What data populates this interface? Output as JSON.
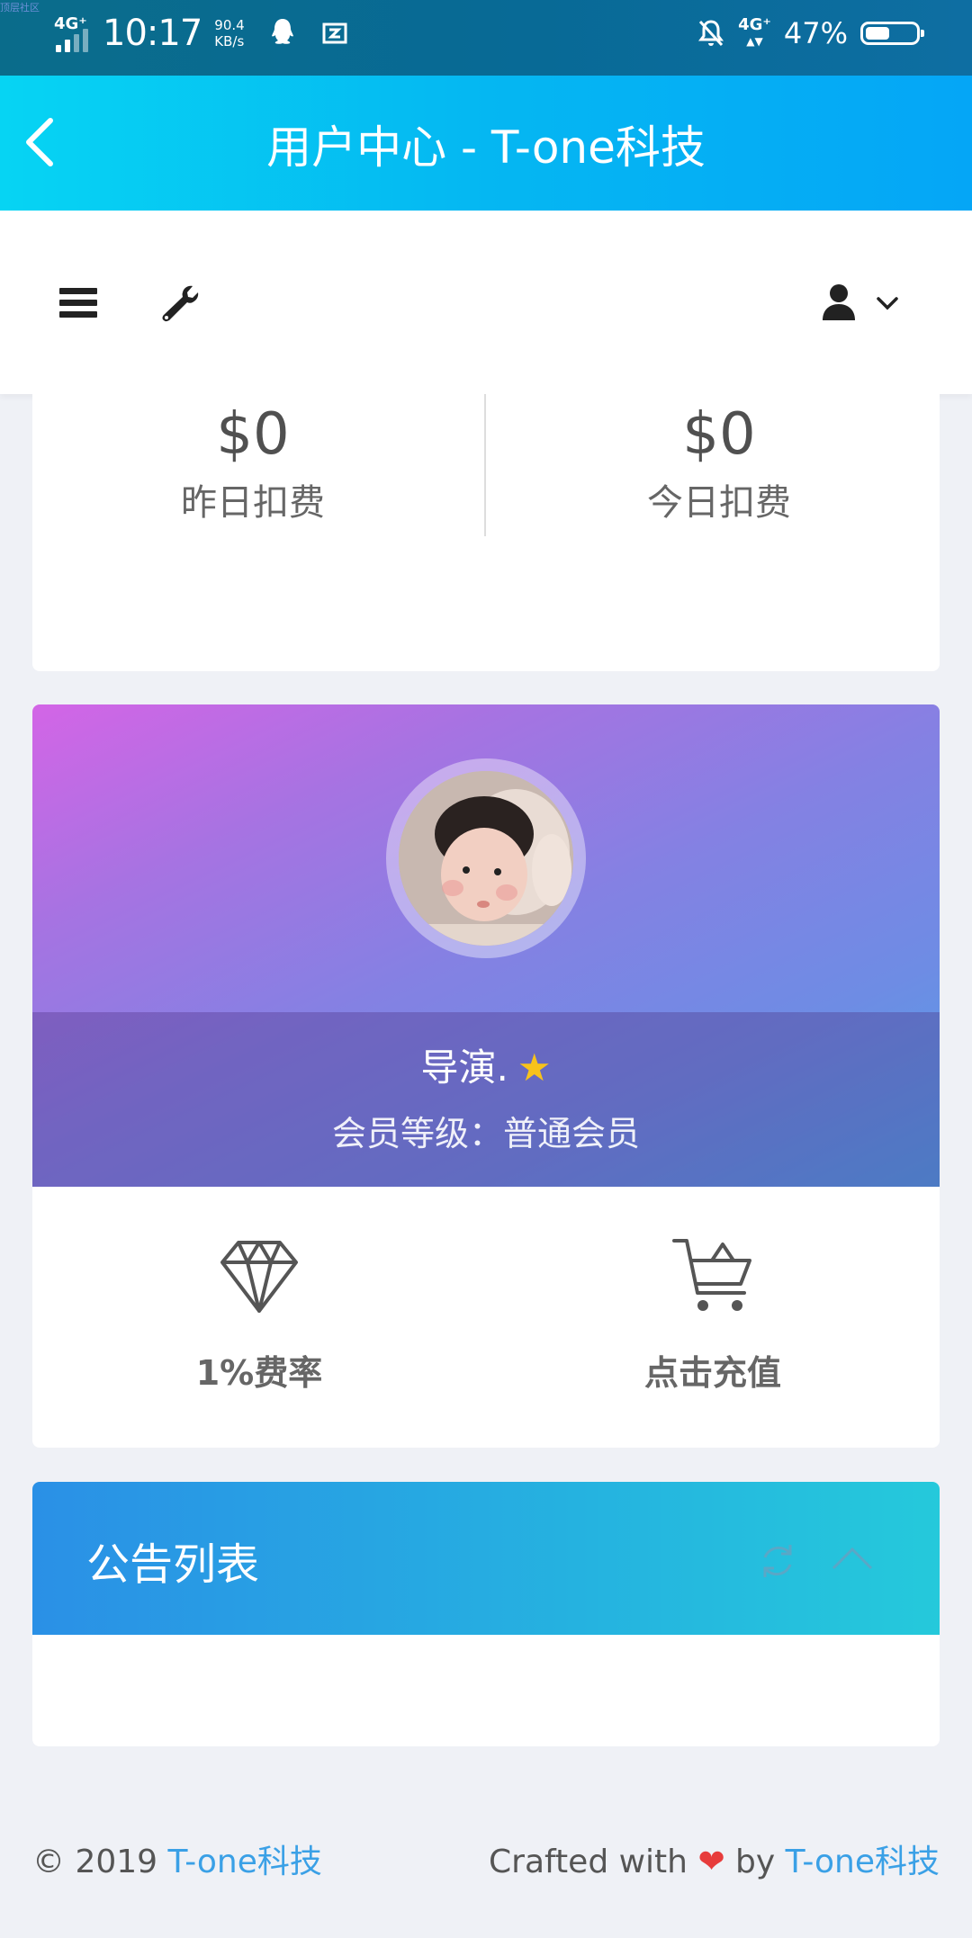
{
  "status_bar": {
    "watermark": "顶层社区",
    "network_left": "4G⁺",
    "time": "10:17",
    "speed_value": "90.4",
    "speed_unit": "KB/s",
    "network_right": "4G⁺",
    "battery": "47%",
    "battery_level": 0.47
  },
  "appbar": {
    "title": "用户中心 - T-one科技"
  },
  "stats": {
    "yesterday": {
      "value": "$0",
      "label": "昨日扣费"
    },
    "today": {
      "value": "$0",
      "label": "今日扣费"
    }
  },
  "profile": {
    "name": "导演.",
    "star": "★",
    "level": "会员等级：普通会员",
    "rate_label": "1%费率",
    "recharge_label": "点击充值"
  },
  "notice": {
    "title": "公告列表"
  },
  "footer": {
    "copyright": "© 2019 ",
    "brand": "T-one科技",
    "crafted": "Crafted with ",
    "heart": "❤",
    "by": " by ",
    "brand2": "T-one科技"
  },
  "colors": {
    "appbar_start": "#06d4f3",
    "appbar_end": "#05a6f6",
    "profile_start": "#d365e6",
    "profile_end": "#4fa2e8",
    "notice_start": "#2a90e6",
    "notice_end": "#25c9db",
    "link": "#3aa0e6",
    "heart": "#e73c3c",
    "star": "#f7c21b"
  }
}
